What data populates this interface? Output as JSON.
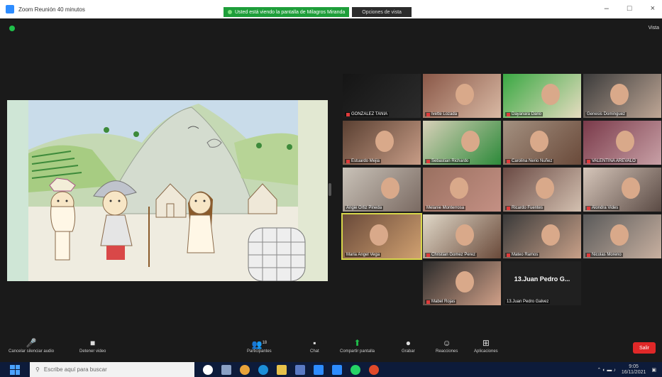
{
  "window": {
    "title": "Zoom Reunión 40 minutos",
    "share_banner": "Usted está viendo la pantalla de Milagros Miranda",
    "share_options": "Opciones de vista",
    "controls": [
      "–",
      "□",
      "×"
    ],
    "view_label": "Vista"
  },
  "participants": [
    {
      "name": "GONZALEZ TANIA",
      "muted": true
    },
    {
      "name": "Ivette Lozada",
      "muted": true
    },
    {
      "name": "Dayanara Dario",
      "muted": true
    },
    {
      "name": "Genesis Dominguez",
      "muted": false
    },
    {
      "name": "Estuardo Mejia",
      "muted": true
    },
    {
      "name": "Sebastian Richardo",
      "muted": true
    },
    {
      "name": "Carolina Nerio Nuñez",
      "muted": true
    },
    {
      "name": "VALENTINA AREVALO",
      "muted": true
    },
    {
      "name": "Angie Ortiz Pineda",
      "muted": false
    },
    {
      "name": "Melanie Monterrosa",
      "muted": false
    },
    {
      "name": "Ricardo Fuentes",
      "muted": true
    },
    {
      "name": "Alondra Vides",
      "muted": true
    },
    {
      "name": "Maria Angel Vega",
      "muted": false
    },
    {
      "name": "Christian Gomez Perez",
      "muted": true
    },
    {
      "name": "Mateo Ramos",
      "muted": true
    },
    {
      "name": "Nicolas Moreno",
      "muted": true
    },
    {
      "name": "Mabel Rojas",
      "muted": true
    },
    {
      "name": "13.Juan Pedro Galvez",
      "muted": false,
      "display": "13.Juan Pedro G..."
    }
  ],
  "toolbar": {
    "mute": "Cancelar silenciar audio",
    "video": "Detener video",
    "participants": "Participantes",
    "participants_count": "18",
    "chat": "Chat",
    "share": "Compartir pantalla",
    "record": "Grabar",
    "reactions": "Reacciones",
    "apps": "Aplicaciones",
    "leave": "Salir"
  },
  "taskbar": {
    "search_placeholder": "Escribe aquí para buscar",
    "time": "9:05",
    "date": "16/11/2021"
  },
  "colors": {
    "share_green": "#1e9e3a",
    "leave_red": "#e02828",
    "zoom_blue": "#2d8cff",
    "active_speaker": "#d7d64a"
  }
}
